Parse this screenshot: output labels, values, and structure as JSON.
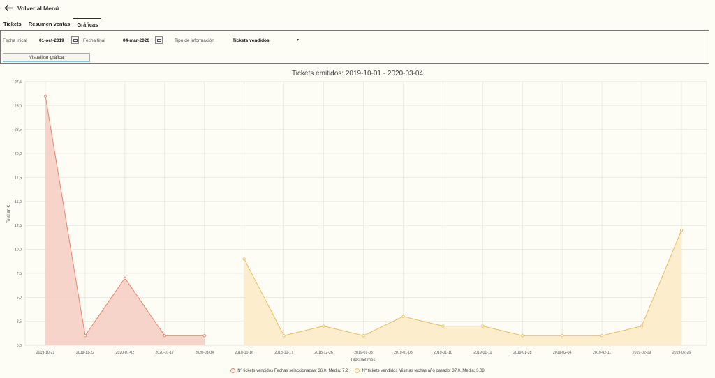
{
  "nav": {
    "back_label": "Volver al Menú"
  },
  "tabs": [
    {
      "label": "Tickets",
      "active": false
    },
    {
      "label": "Resumen ventas",
      "active": false
    },
    {
      "label": "Gráficas",
      "active": true
    }
  ],
  "filters": {
    "start_label": "Fecha inical",
    "start_value": "01-oct-2019",
    "end_label": "Fecha final",
    "end_value": "04-mar-2020",
    "type_label": "Tipo de información",
    "type_value": "Tickets vendidos",
    "button_label": "Visualizar gráfica"
  },
  "chart_data": {
    "type": "area",
    "title": "Tickets emitidos: 2019-10-01 - 2020-03-04",
    "xlabel": "Días del mes",
    "ylabel": "Total en €",
    "ylim": [
      0,
      27.5
    ],
    "yticks": [
      "0,0",
      "2,5",
      "5,0",
      "7,5",
      "10,0",
      "12,5",
      "15,0",
      "17,5",
      "20,0",
      "22,5",
      "25,0",
      "27,5"
    ],
    "categories": [
      "2019-10-21",
      "2019-11-22",
      "2020-01-02",
      "2020-01-17",
      "2020-03-04",
      "2018-10-16",
      "2018-10-17",
      "2018-12-26",
      "2019-01-03",
      "2019-01-08",
      "2019-01-10",
      "2019-01-11",
      "2019-01-28",
      "2019-02-04",
      "2019-02-11",
      "2019-02-19",
      "2019-02-26"
    ],
    "grid": true,
    "legend_position": "bottom",
    "series": [
      {
        "name": "Nº tickets vendidos Fechas seleccionadas: 36,0, Media: 7,2",
        "color": "#e8846a",
        "fill": "#f6cfc4",
        "values": [
          26,
          1,
          7,
          1,
          1,
          null,
          null,
          null,
          null,
          null,
          null,
          null,
          null,
          null,
          null,
          null,
          null
        ]
      },
      {
        "name": "Nº tickets vendidos Mismas fechas año pasado: 37,0, Media: 3,08",
        "color": "#eebc5c",
        "fill": "#fcecc9",
        "values": [
          null,
          null,
          null,
          null,
          null,
          9,
          1,
          2,
          1,
          3,
          2,
          2,
          1,
          1,
          1,
          2,
          12
        ]
      }
    ]
  }
}
